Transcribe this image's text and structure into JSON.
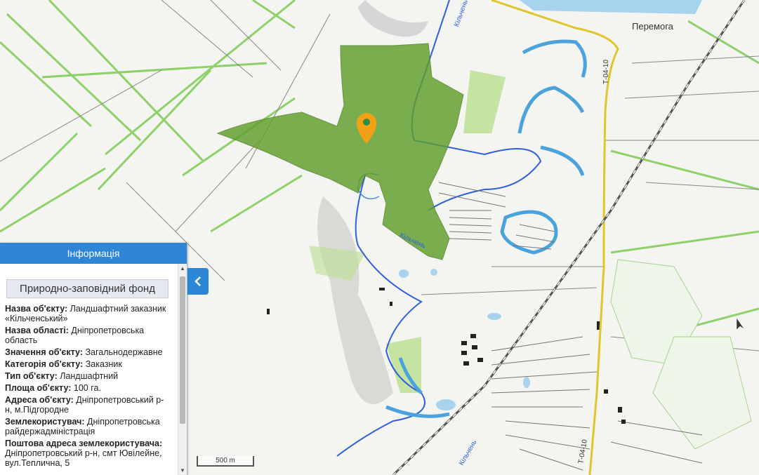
{
  "map": {
    "place_label": "Перемога",
    "road_label_top": "Т-04-10",
    "road_label_bottom": "Т-04-10",
    "river_label_top": "Кільчень",
    "river_label_mid": "Кільчень",
    "river_label_bottom": "Кільчень",
    "reserve_color": "#5f9e2a",
    "marker_color": "#f2a014",
    "scale_label": "500 m"
  },
  "panel": {
    "title": "Інформація",
    "fund_title": "Природно-заповідний фонд",
    "rows": [
      {
        "label": "Назва об'єкту:",
        "value": "Ландшафтний заказник «Кільченський»"
      },
      {
        "label": "Назва області:",
        "value": "Дніпропетровська область"
      },
      {
        "label": "Значення об'єкту:",
        "value": "Загальнодержавне"
      },
      {
        "label": "Категорія об'єкту:",
        "value": "Заказник"
      },
      {
        "label": "Тип об'єкту:",
        "value": "Ландшафтний"
      },
      {
        "label": "Площа об'єкту:",
        "value": "100 га."
      },
      {
        "label": "Адреса об'єкту:",
        "value": "Дніпропетровський р-н, м.Підгородне"
      },
      {
        "label": "Землекористувач:",
        "value": "Дніпропетровська райдержадміністрація"
      },
      {
        "label": "Поштова адреса землекористувача:",
        "value": "Дніпропетровський р-н, смт Ювілейне, вул.Теплична, 5"
      }
    ],
    "collapse_icon": "chevron-left-icon"
  }
}
